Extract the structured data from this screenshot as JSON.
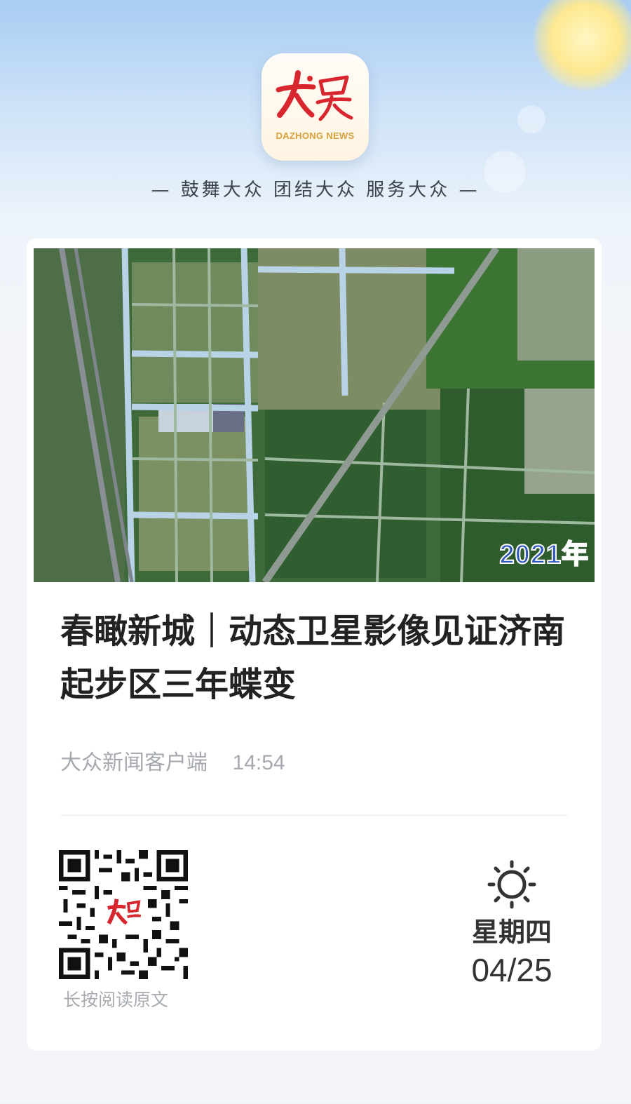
{
  "header": {
    "logo_text": "DAZHONG NEWS",
    "tagline": "— 鼓舞大众  团结大众  服务大众 —"
  },
  "article": {
    "image_year_badge": "2021年",
    "title": "春瞰新城｜动态卫星影像见证济南起步区三年蝶变",
    "source": "大众新闻客户端",
    "time": "14:54"
  },
  "footer": {
    "qr_caption": "长按阅读原文",
    "weather_icon": "sun-icon",
    "weekday": "星期四",
    "date": "04/25"
  },
  "colors": {
    "brand_red": "#d7262e",
    "brand_gold": "#d8a13b",
    "sky_blue": "#a9cdf3"
  }
}
